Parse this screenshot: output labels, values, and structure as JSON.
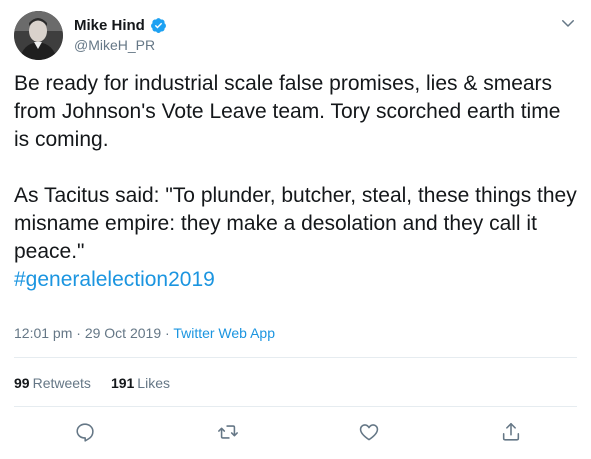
{
  "user": {
    "display_name": "Mike Hind",
    "handle": "@MikeH_PR",
    "verified": true
  },
  "tweet": {
    "paragraph1": "Be ready for industrial scale false promises, lies & smears  from Johnson's Vote Leave team. Tory scorched earth time is coming.",
    "paragraph2": "As Tacitus said: \"To plunder, butcher, steal, these things they misname empire: they make a desolation and they call it peace.\"",
    "hashtag": "#generalelection2019"
  },
  "meta": {
    "time": "12:01 pm",
    "separator1": " · ",
    "date": "29 Oct 2019",
    "separator2": " · ",
    "source": "Twitter Web App"
  },
  "stats": {
    "retweets_count": "99",
    "retweets_label": "Retweets",
    "likes_count": "191",
    "likes_label": "Likes"
  },
  "icons": {
    "reply": "reply-icon",
    "retweet": "retweet-icon",
    "like": "heart-icon",
    "share": "share-icon",
    "caret": "chevron-down-icon",
    "verified": "verified-badge-icon"
  },
  "colors": {
    "link": "#1b95e0",
    "secondary_text": "#657786",
    "primary_text": "#14171a",
    "divider": "#e6ecf0",
    "verified": "#1da1f2"
  }
}
